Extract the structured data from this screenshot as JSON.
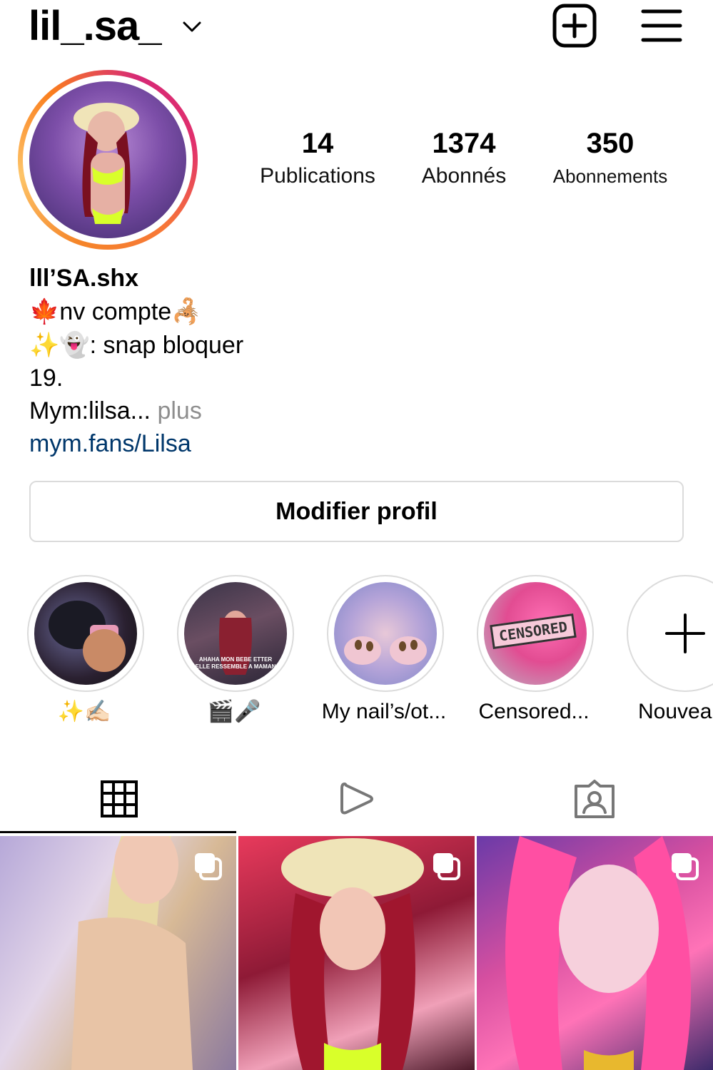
{
  "header": {
    "username": "lil_.sa_"
  },
  "stats": {
    "posts": {
      "value": "14",
      "label": "Publications"
    },
    "followers": {
      "value": "1374",
      "label": "Abonnés"
    },
    "following": {
      "value": "350",
      "label": "Abonnements"
    }
  },
  "bio": {
    "display_name": "lll’SA.shx",
    "line1": "🍁nv compte🦂",
    "line2": "✨👻: snap bloquer",
    "line3": "19.",
    "line4": "Mym:lilsa...",
    "more": "plus",
    "link": "mym.fans/Lilsa"
  },
  "edit_profile_label": "Modifier profil",
  "highlights": [
    {
      "caption": "✨✍🏻"
    },
    {
      "caption": "🎬🎤"
    },
    {
      "caption": "My nail’s/ot..."
    },
    {
      "caption": "Censored...",
      "badge": "CENSORED"
    },
    {
      "caption": "Nouveau"
    }
  ],
  "highlight_2_text": "AHAHA MON BEBE ETTER ELLE RESSEMBLE A MAMAN",
  "tabs": [
    {
      "icon": "grid-icon",
      "selected": true
    },
    {
      "icon": "reels-icon",
      "selected": false
    },
    {
      "icon": "tagged-icon",
      "selected": false
    }
  ],
  "colors": {
    "link": "#00376b",
    "muted": "#8e8e8e",
    "border": "#dbdbdb"
  }
}
